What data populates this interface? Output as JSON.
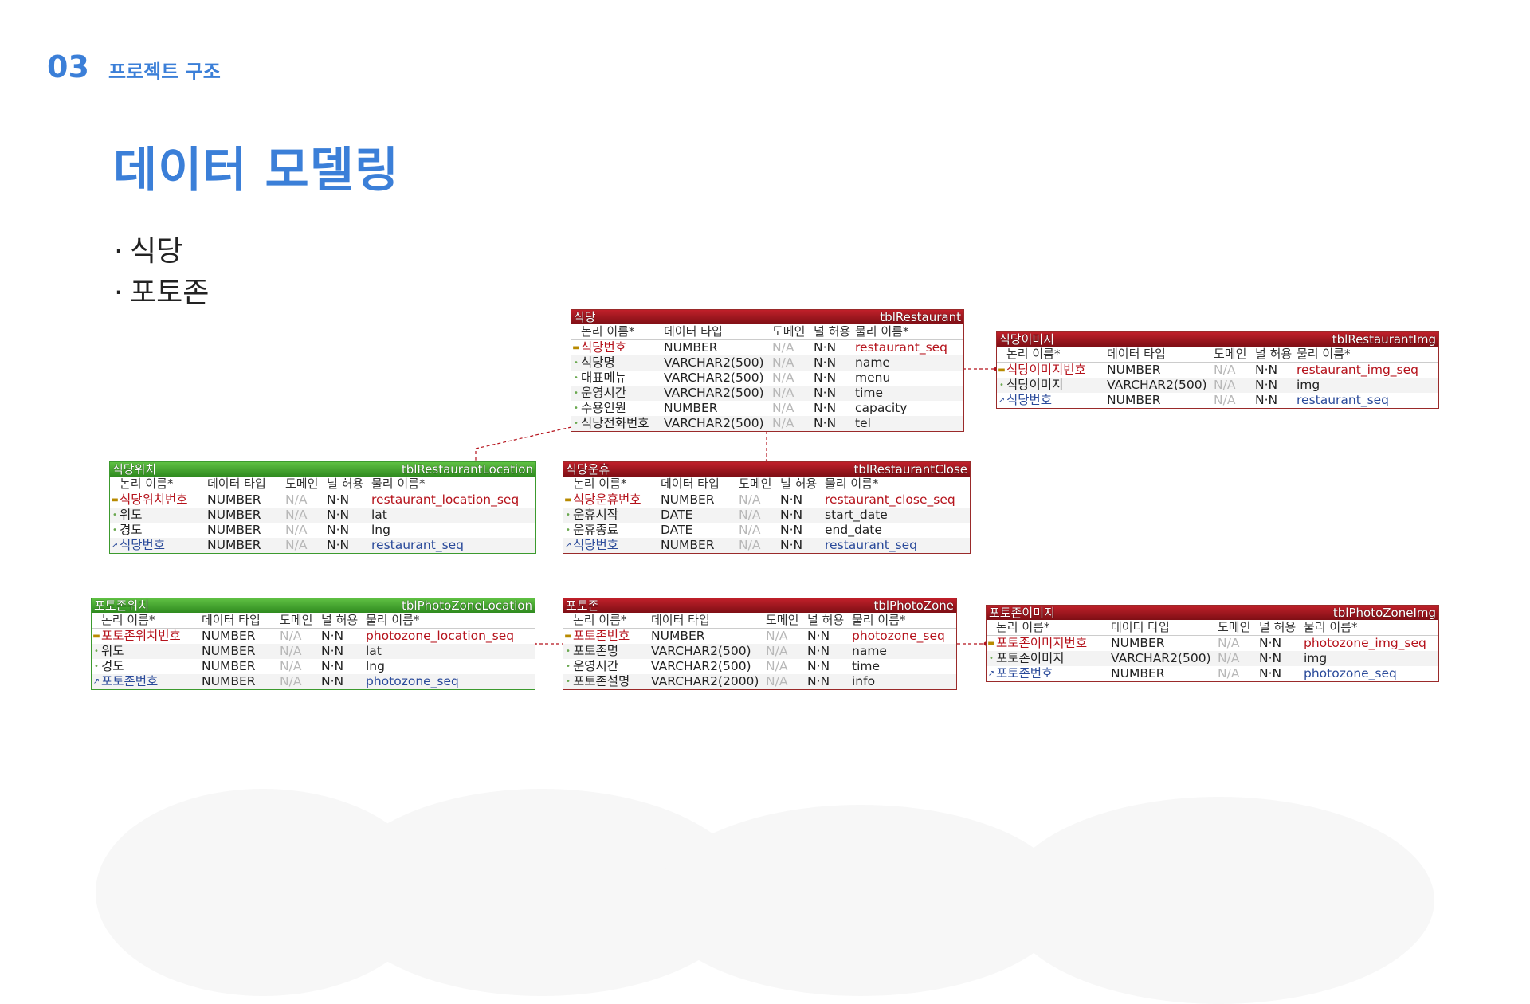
{
  "header": {
    "section_number": "03",
    "section_title": "프로젝트 구조"
  },
  "page_title": "데이터 모델링",
  "bullets": [
    "식당",
    "포토존"
  ],
  "column_headers": {
    "logical": "논리 이름*",
    "datatype": "데이터 타입",
    "domain": "도메인",
    "null": "널 허용",
    "physical": "물리 이름*"
  },
  "tables": {
    "restaurant": {
      "logical_name": "식당",
      "physical_name": "tblRestaurant",
      "rows": [
        {
          "logical": "식당번호",
          "type": "NUMBER",
          "domain": "N/A",
          "null": "N·N",
          "physical": "restaurant_seq",
          "key": "pk"
        },
        {
          "logical": "식당명",
          "type": "VARCHAR2(500)",
          "domain": "N/A",
          "null": "N·N",
          "physical": "name",
          "key": ""
        },
        {
          "logical": "대표메뉴",
          "type": "VARCHAR2(500)",
          "domain": "N/A",
          "null": "N·N",
          "physical": "menu",
          "key": ""
        },
        {
          "logical": "운영시간",
          "type": "VARCHAR2(500)",
          "domain": "N/A",
          "null": "N·N",
          "physical": "time",
          "key": ""
        },
        {
          "logical": "수용인원",
          "type": "NUMBER",
          "domain": "N/A",
          "null": "N·N",
          "physical": "capacity",
          "key": ""
        },
        {
          "logical": "식당전화번호",
          "type": "VARCHAR2(500)",
          "domain": "N/A",
          "null": "N·N",
          "physical": "tel",
          "key": ""
        }
      ]
    },
    "restaurant_img": {
      "logical_name": "식당이미지",
      "physical_name": "tblRestaurantImg",
      "rows": [
        {
          "logical": "식당이미지번호",
          "type": "NUMBER",
          "domain": "N/A",
          "null": "N·N",
          "physical": "restaurant_img_seq",
          "key": "pk"
        },
        {
          "logical": "식당이미지",
          "type": "VARCHAR2(500)",
          "domain": "N/A",
          "null": "N·N",
          "physical": "img",
          "key": ""
        },
        {
          "logical": "식당번호",
          "type": "NUMBER",
          "domain": "N/A",
          "null": "N·N",
          "physical": "restaurant_seq",
          "key": "fk"
        }
      ]
    },
    "restaurant_location": {
      "logical_name": "식당위치",
      "physical_name": "tblRestaurantLocation",
      "rows": [
        {
          "logical": "식당위치번호",
          "type": "NUMBER",
          "domain": "N/A",
          "null": "N·N",
          "physical": "restaurant_location_seq",
          "key": "pk"
        },
        {
          "logical": "위도",
          "type": "NUMBER",
          "domain": "N/A",
          "null": "N·N",
          "physical": "lat",
          "key": ""
        },
        {
          "logical": "경도",
          "type": "NUMBER",
          "domain": "N/A",
          "null": "N·N",
          "physical": "lng",
          "key": ""
        },
        {
          "logical": "식당번호",
          "type": "NUMBER",
          "domain": "N/A",
          "null": "N·N",
          "physical": "restaurant_seq",
          "key": "fk"
        }
      ]
    },
    "restaurant_close": {
      "logical_name": "식당운휴",
      "physical_name": "tblRestaurantClose",
      "rows": [
        {
          "logical": "식당운휴번호",
          "type": "NUMBER",
          "domain": "N/A",
          "null": "N·N",
          "physical": "restaurant_close_seq",
          "key": "pk"
        },
        {
          "logical": "운휴시작",
          "type": "DATE",
          "domain": "N/A",
          "null": "N·N",
          "physical": "start_date",
          "key": ""
        },
        {
          "logical": "운휴종료",
          "type": "DATE",
          "domain": "N/A",
          "null": "N·N",
          "physical": "end_date",
          "key": ""
        },
        {
          "logical": "식당번호",
          "type": "NUMBER",
          "domain": "N/A",
          "null": "N·N",
          "physical": "restaurant_seq",
          "key": "fk"
        }
      ]
    },
    "photozone_location": {
      "logical_name": "포토존위치",
      "physical_name": "tblPhotoZoneLocation",
      "rows": [
        {
          "logical": "포토존위치번호",
          "type": "NUMBER",
          "domain": "N/A",
          "null": "N·N",
          "physical": "photozone_location_seq",
          "key": "pk"
        },
        {
          "logical": "위도",
          "type": "NUMBER",
          "domain": "N/A",
          "null": "N·N",
          "physical": "lat",
          "key": ""
        },
        {
          "logical": "경도",
          "type": "NUMBER",
          "domain": "N/A",
          "null": "N·N",
          "physical": "lng",
          "key": ""
        },
        {
          "logical": "포토존번호",
          "type": "NUMBER",
          "domain": "N/A",
          "null": "N·N",
          "physical": "photozone_seq",
          "key": "fk"
        }
      ]
    },
    "photozone": {
      "logical_name": "포토존",
      "physical_name": "tblPhotoZone",
      "rows": [
        {
          "logical": "포토존번호",
          "type": "NUMBER",
          "domain": "N/A",
          "null": "N·N",
          "physical": "photozone_seq",
          "key": "pk"
        },
        {
          "logical": "포토존명",
          "type": "VARCHAR2(500)",
          "domain": "N/A",
          "null": "N·N",
          "physical": "name",
          "key": ""
        },
        {
          "logical": "운영시간",
          "type": "VARCHAR2(500)",
          "domain": "N/A",
          "null": "N·N",
          "physical": "time",
          "key": ""
        },
        {
          "logical": "포토존설명",
          "type": "VARCHAR2(2000)",
          "domain": "N/A",
          "null": "N·N",
          "physical": "info",
          "key": ""
        }
      ]
    },
    "photozone_img": {
      "logical_name": "포토존이미지",
      "physical_name": "tblPhotoZoneImg",
      "rows": [
        {
          "logical": "포토존이미지번호",
          "type": "NUMBER",
          "domain": "N/A",
          "null": "N·N",
          "physical": "photozone_img_seq",
          "key": "pk"
        },
        {
          "logical": "포토존이미지",
          "type": "VARCHAR2(500)",
          "domain": "N/A",
          "null": "N·N",
          "physical": "img",
          "key": ""
        },
        {
          "logical": "포토존번호",
          "type": "NUMBER",
          "domain": "N/A",
          "null": "N·N",
          "physical": "photozone_seq",
          "key": "fk"
        }
      ]
    }
  },
  "colors": {
    "accent": "#3b7fd8",
    "table_red": "#a3161d",
    "table_green": "#3c9a2e",
    "pk_text": "#b5121b",
    "fk_text": "#2a4a9a"
  }
}
